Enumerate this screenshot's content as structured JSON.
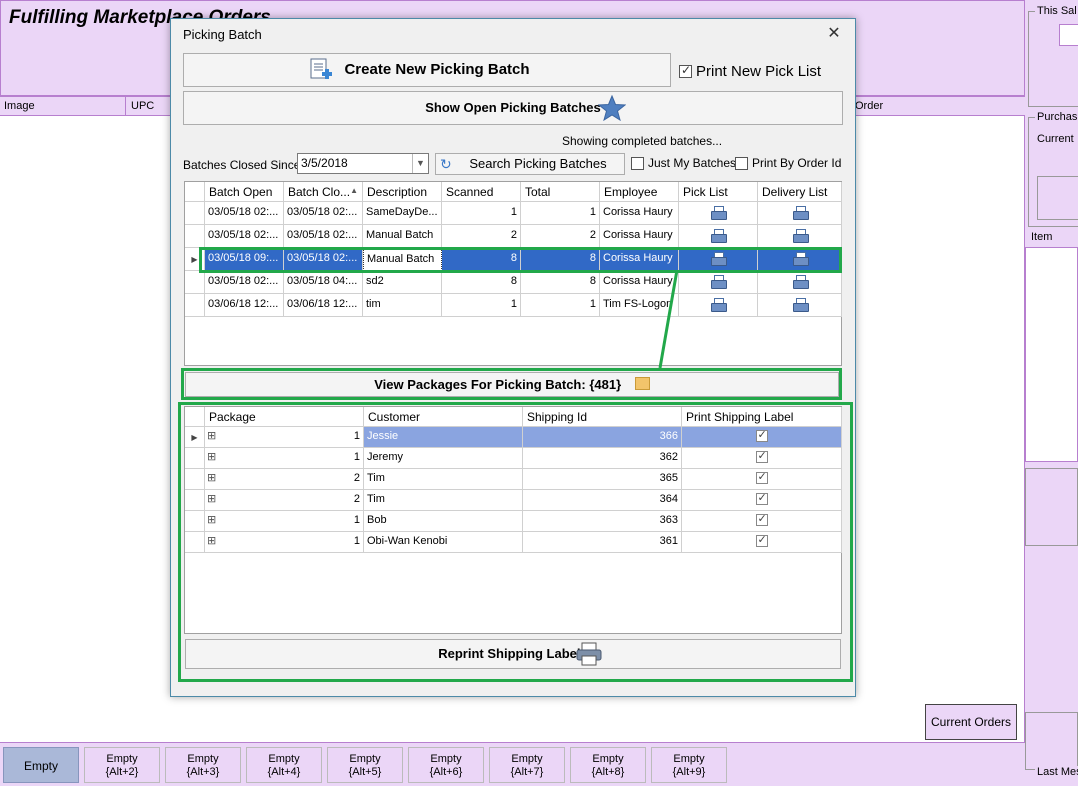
{
  "app": {
    "title": "Fulfilling Marketplace Orders",
    "columns": [
      "Image",
      "UPC",
      "Order"
    ],
    "right_panel": {
      "this_sale": "This Sal",
      "purchase": "Purchas",
      "current": "Current",
      "item": "Item",
      "last_message": "Last Mes"
    },
    "current_orders_label": "Current Orders",
    "tabs": [
      {
        "label": "Empty",
        "shortcut": ""
      },
      {
        "label": "Empty",
        "shortcut": "{Alt+2}"
      },
      {
        "label": "Empty",
        "shortcut": "{Alt+3}"
      },
      {
        "label": "Empty",
        "shortcut": "{Alt+4}"
      },
      {
        "label": "Empty",
        "shortcut": "{Alt+5}"
      },
      {
        "label": "Empty",
        "shortcut": "{Alt+6}"
      },
      {
        "label": "Empty",
        "shortcut": "{Alt+7}"
      },
      {
        "label": "Empty",
        "shortcut": "{Alt+8}"
      },
      {
        "label": "Empty",
        "shortcut": "{Alt+9}"
      }
    ]
  },
  "dialog": {
    "title": "Picking Batch",
    "create_batch_label": "Create New Picking Batch",
    "print_new_pick_list_label": "Print New Pick List",
    "print_new_pick_list_checked": true,
    "show_open_batches_label": "Show Open Picking Batches",
    "status_text": "Showing completed batches...",
    "batches_closed_since_label": "Batches Closed Since:",
    "batches_closed_since_value": "3/5/2018",
    "search_label": "Search Picking Batches",
    "just_my_batches_label": "Just My Batches",
    "print_by_order_id_label": "Print By Order Id",
    "batch_columns": [
      "Batch Open",
      "Batch Clo...",
      "Description",
      "Scanned",
      "Total",
      "Employee",
      "Pick List",
      "Delivery List"
    ],
    "batches": [
      {
        "open": "03/05/18 02:...",
        "closed": "03/05/18 02:...",
        "description": "SameDayDe...",
        "scanned": "1",
        "total": "1",
        "employee": "Corissa Haury"
      },
      {
        "open": "03/05/18 02:...",
        "closed": "03/05/18 02:...",
        "description": "Manual Batch",
        "scanned": "2",
        "total": "2",
        "employee": "Corissa Haury"
      },
      {
        "open": "03/05/18 09:...",
        "closed": "03/05/18 02:...",
        "description": "Manual Batch",
        "scanned": "8",
        "total": "8",
        "employee": "Corissa Haury"
      },
      {
        "open": "03/05/18 02:...",
        "closed": "03/05/18 04:...",
        "description": "sd2",
        "scanned": "8",
        "total": "8",
        "employee": "Corissa Haury"
      },
      {
        "open": "03/06/18 12:...",
        "closed": "03/06/18 12:...",
        "description": "tim",
        "scanned": "1",
        "total": "1",
        "employee": "Tim FS-Logon"
      }
    ],
    "view_packages_label": "View Packages For Picking Batch: {481}",
    "package_columns": [
      "Package",
      "Customer",
      "Shipping Id",
      "Print Shipping Label"
    ],
    "packages": [
      {
        "package": "1",
        "customer": "Jessie",
        "shipping_id": "366"
      },
      {
        "package": "1",
        "customer": "Jeremy",
        "shipping_id": "362"
      },
      {
        "package": "2",
        "customer": "Tim",
        "shipping_id": "365"
      },
      {
        "package": "2",
        "customer": "Tim",
        "shipping_id": "364"
      },
      {
        "package": "1",
        "customer": "Bob",
        "shipping_id": "363"
      },
      {
        "package": "1",
        "customer": "Obi-Wan Kenobi",
        "shipping_id": "361"
      }
    ],
    "reprint_label": "Reprint Shipping Labels"
  },
  "colors": {
    "app_bg": "#ebd6f7",
    "selection": "#3169c6",
    "highlight": "#22a84a"
  }
}
